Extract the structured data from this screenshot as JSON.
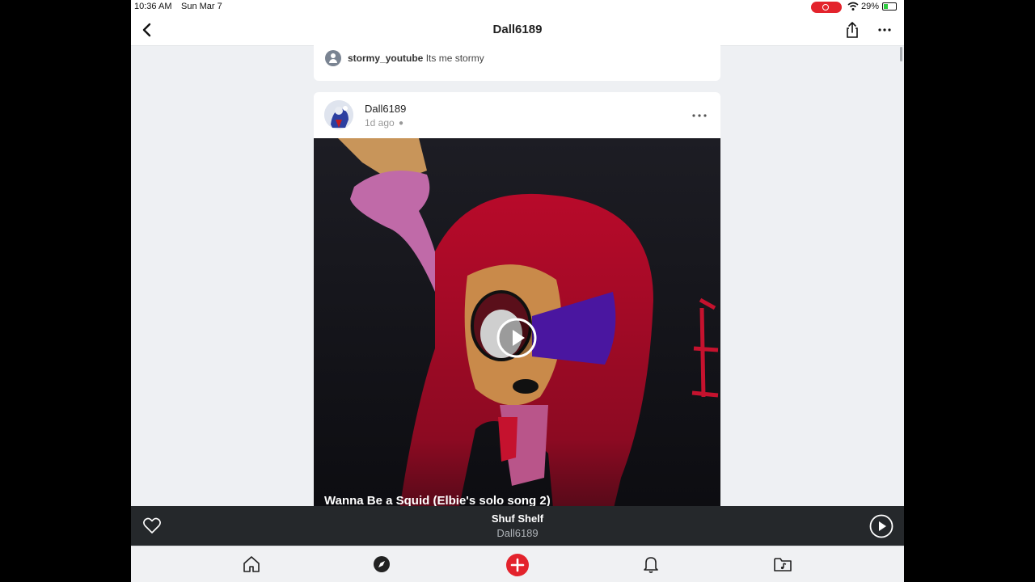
{
  "status_bar": {
    "time": "10:36 AM",
    "date": "Sun Mar 7",
    "battery": "29%"
  },
  "nav": {
    "title": "Dall6189",
    "back_icon": "chevron-left-icon",
    "share_icon": "share-icon",
    "more_icon": "ellipsis-icon"
  },
  "comment": {
    "username": "stormy_youtube",
    "text": "Its me stormy"
  },
  "post": {
    "username": "Dall6189",
    "time": "1d ago",
    "platform_icon": "apple-icon",
    "video_caption": "Wanna Be a Squid (Elbie's solo song 2)"
  },
  "player": {
    "title": "Shuf Shelf",
    "artist": "Dall6189"
  },
  "tabs": [
    "home-icon",
    "explore-icon",
    "create-icon",
    "notifications-icon",
    "library-icon"
  ],
  "colors": {
    "accent": "#e3232c",
    "player_bg": "#25282b",
    "page_bg": "#eef0f3"
  }
}
